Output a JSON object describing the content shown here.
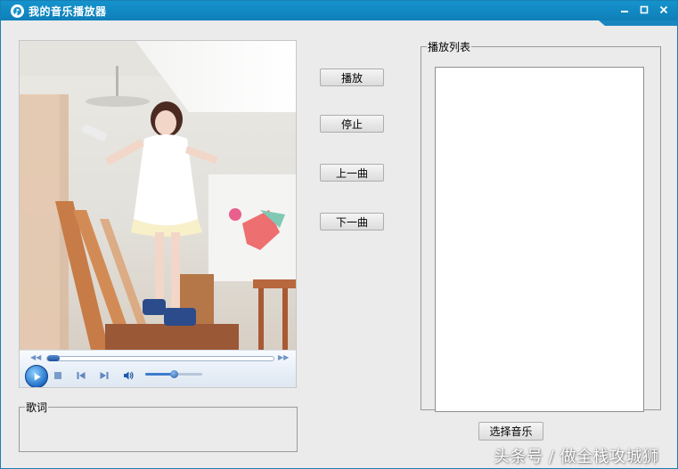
{
  "window": {
    "title": "我的音乐播放器"
  },
  "controls": {
    "play_label": "播放",
    "stop_label": "停止",
    "prev_label": "上一曲",
    "next_label": "下一曲",
    "select_music_label": "选择音乐"
  },
  "playlist": {
    "legend": "播放列表",
    "items": []
  },
  "lyrics": {
    "legend": "歌词"
  },
  "media_player": {
    "seek_progress": 0.0,
    "volume_level": 0.5
  },
  "watermark": {
    "text": "头条号 / 做全栈攻城狮"
  },
  "colors": {
    "titlebar": "#1288c3",
    "window_bg": "#ebebeb",
    "player_accent": "#1f6ec7"
  }
}
